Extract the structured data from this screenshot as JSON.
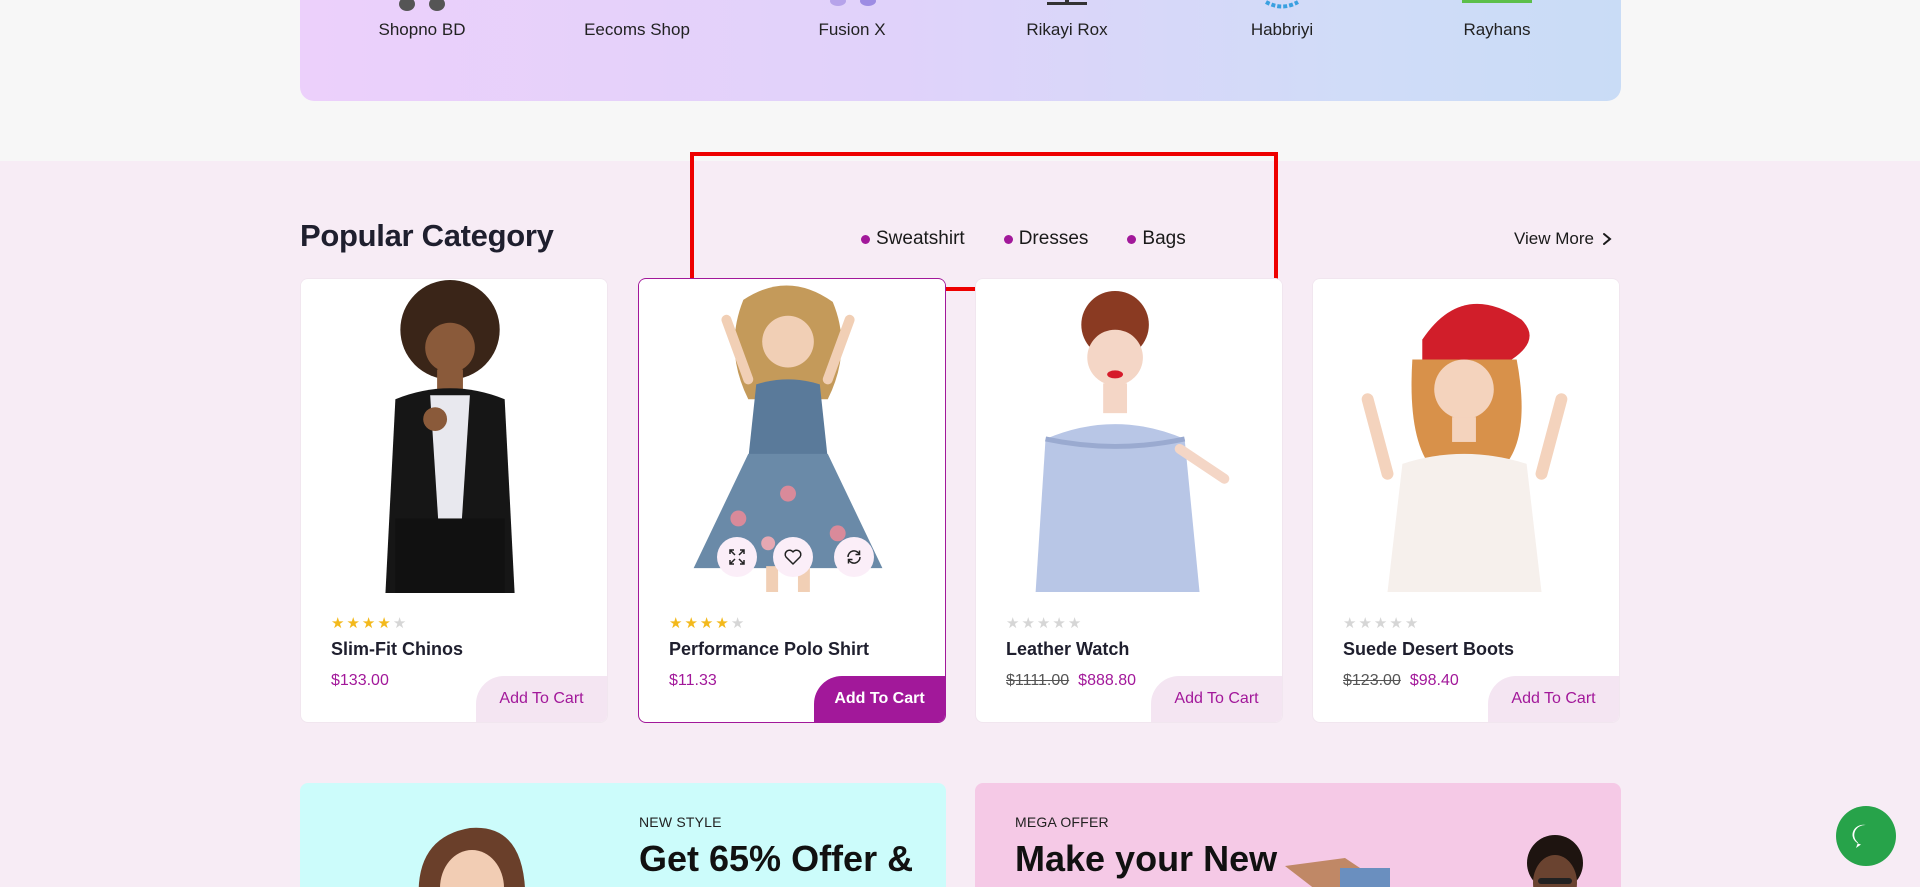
{
  "brands": [
    {
      "name": "Shopno BD"
    },
    {
      "name": "Eecoms Shop"
    },
    {
      "name": "Fusion X"
    },
    {
      "name": "Rikayi Rox"
    },
    {
      "name": "Habbriyi"
    },
    {
      "name": "Rayhans"
    }
  ],
  "category": {
    "title": "Popular Category",
    "tabs": [
      "Sweatshirt",
      "Dresses",
      "Bags"
    ],
    "view_more": "View More"
  },
  "products": [
    {
      "name": "Slim-Fit Chinos",
      "rating": 4,
      "old_price": "",
      "price": "$133.00",
      "cart": "Add To Cart"
    },
    {
      "name": "Performance Polo Shirt",
      "rating": 4,
      "old_price": "",
      "price": "$11.33",
      "cart": "Add To Cart"
    },
    {
      "name": "Leather Watch",
      "rating": 0,
      "old_price": "$1111.00",
      "price": "$888.80",
      "cart": "Add To Cart"
    },
    {
      "name": "Suede Desert Boots",
      "rating": 0,
      "old_price": "$123.00",
      "price": "$98.40",
      "cart": "Add To Cart"
    }
  ],
  "promos": [
    {
      "eyebrow": "NEW STYLE",
      "headline": "Get 65% Offer &"
    },
    {
      "eyebrow": "MEGA OFFER",
      "headline": "Make your New"
    }
  ],
  "icons": {
    "expand": "expand-icon",
    "wishlist": "heart-icon",
    "compare": "refresh-icon",
    "view_more": "chevron-right-icon",
    "chat": "chat-icon"
  },
  "colors": {
    "accent": "#a2189a",
    "star": "#f3b91c",
    "chat": "#27a34a",
    "section_bg": "#f7ecf5"
  }
}
